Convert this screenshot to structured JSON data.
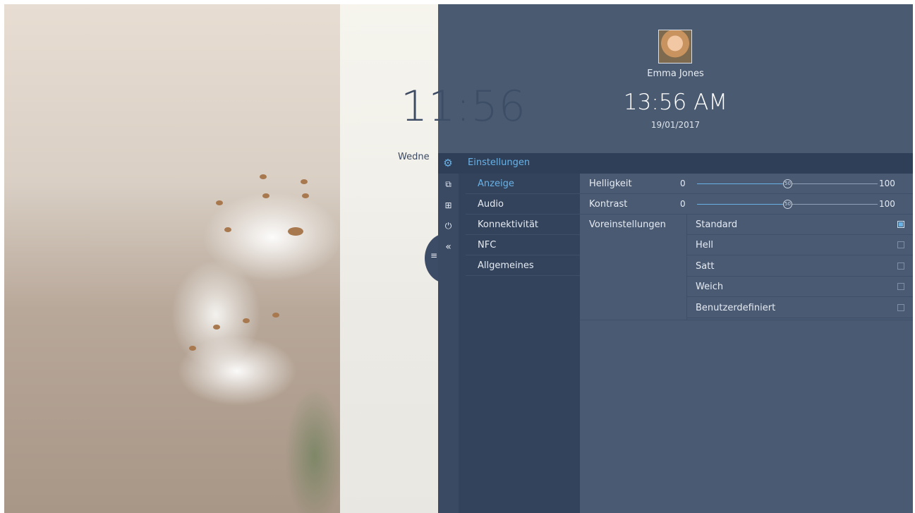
{
  "background": {
    "clock": "11:56",
    "day_partial": "Wedne"
  },
  "profile": {
    "name": "Emma Jones",
    "time": "13:56 AM",
    "date": "19/01/2017"
  },
  "settings": {
    "title": "Einstellungen",
    "rail_icons": [
      "display-settings-icon",
      "screen-settings-icon",
      "power-icon",
      "collapse-icon"
    ],
    "menu": [
      {
        "label": "Anzeige",
        "active": true
      },
      {
        "label": "Audio",
        "active": false
      },
      {
        "label": "Konnektivität",
        "active": false
      },
      {
        "label": "NFC",
        "active": false
      },
      {
        "label": "Allgemeines",
        "active": false
      }
    ]
  },
  "display": {
    "brightness": {
      "label": "Helligkeit",
      "min": "0",
      "max": "100",
      "value": 50,
      "thumb_label": "50"
    },
    "contrast": {
      "label": "Kontrast",
      "min": "0",
      "max": "100",
      "value": 50,
      "thumb_label": "50"
    },
    "presets_label": "Voreinstellungen",
    "presets": [
      {
        "label": "Standard",
        "checked": true
      },
      {
        "label": "Hell",
        "checked": false
      },
      {
        "label": "Satt",
        "checked": false
      },
      {
        "label": "Weich",
        "checked": false
      },
      {
        "label": "Benutzerdefiniert",
        "checked": false
      }
    ]
  },
  "colors": {
    "accent": "#6ab2e6",
    "panel": "#3c4d66",
    "menu": "#33435c",
    "content": "#4a5a73"
  }
}
